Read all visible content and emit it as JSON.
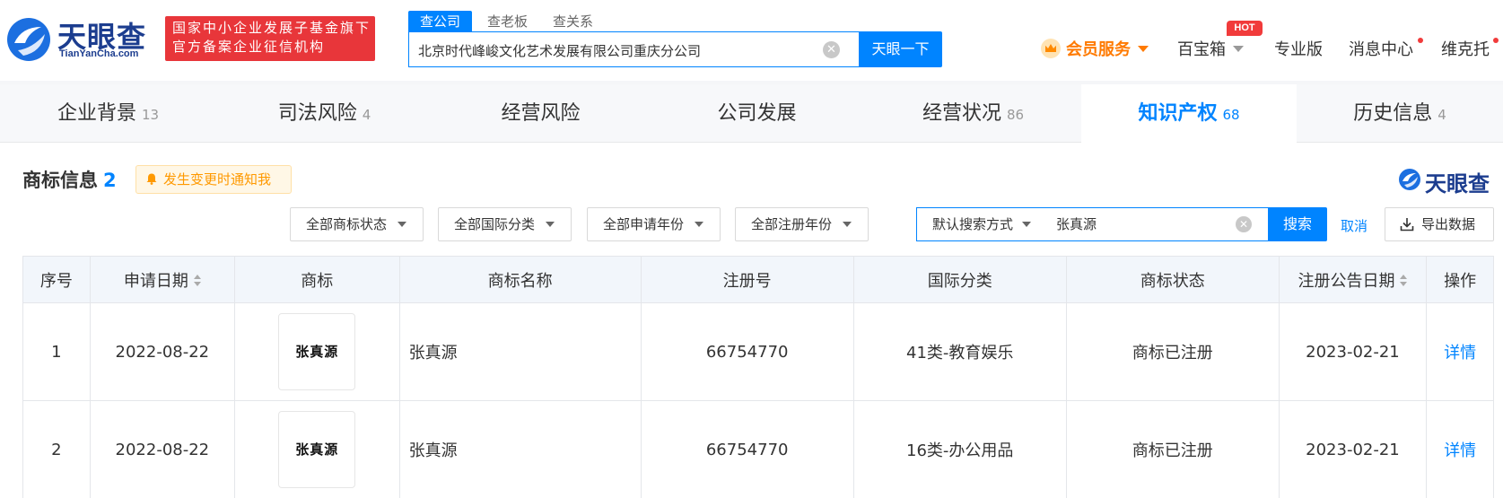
{
  "header": {
    "logo": {
      "name": "天眼查",
      "url": "TianYanCha.com"
    },
    "badge": {
      "line1": "国家中小企业发展子基金旗下",
      "line2": "官方备案企业征信机构"
    },
    "search_tabs": [
      "查公司",
      "查老板",
      "查关系"
    ],
    "search_value": "北京时代峰峻文化艺术发展有限公司重庆分公司",
    "search_button": "天眼一下",
    "nav": {
      "vip": "会员服务",
      "treasure": "百宝箱",
      "hot": "HOT",
      "pro": "专业版",
      "messages": "消息中心",
      "user": "维克托"
    },
    "colors": {
      "brand": "#0084ff",
      "vip": "#ff7a00",
      "badge": "#e8363a"
    }
  },
  "mainnav": [
    {
      "label": "企业背景",
      "count": "13"
    },
    {
      "label": "司法风险",
      "count": "4"
    },
    {
      "label": "经营风险",
      "count": ""
    },
    {
      "label": "公司发展",
      "count": ""
    },
    {
      "label": "经营状况",
      "count": "86"
    },
    {
      "label": "知识产权",
      "count": "68",
      "active": true
    },
    {
      "label": "历史信息",
      "count": "4"
    }
  ],
  "section": {
    "title": "商标信息",
    "count": "2",
    "notify": "发生变更时通知我",
    "brand": "天眼查"
  },
  "filters": {
    "status": "全部商标状态",
    "intl_class": "全部国际分类",
    "apply_year": "全部申请年份",
    "reg_year": "全部注册年份",
    "search_mode": "默认搜索方式",
    "keyword": "张真源",
    "search_button": "搜索",
    "cancel": "取消",
    "export": "导出数据"
  },
  "table": {
    "headers": [
      "序号",
      "申请日期",
      "商标",
      "商标名称",
      "注册号",
      "国际分类",
      "商标状态",
      "注册公告日期",
      "操作"
    ],
    "rows": [
      {
        "no": "1",
        "apply_date": "2022-08-22",
        "logo_text": "张真源",
        "name": "张真源",
        "reg_no": "66754770",
        "class": "41类-教育娱乐",
        "status": "商标已注册",
        "pub_date": "2023-02-21",
        "action": "详情"
      },
      {
        "no": "2",
        "apply_date": "2022-08-22",
        "logo_text": "张真源",
        "name": "张真源",
        "reg_no": "66754770",
        "class": "16类-办公用品",
        "status": "商标已注册",
        "pub_date": "2023-02-21",
        "action": "详情"
      }
    ]
  }
}
